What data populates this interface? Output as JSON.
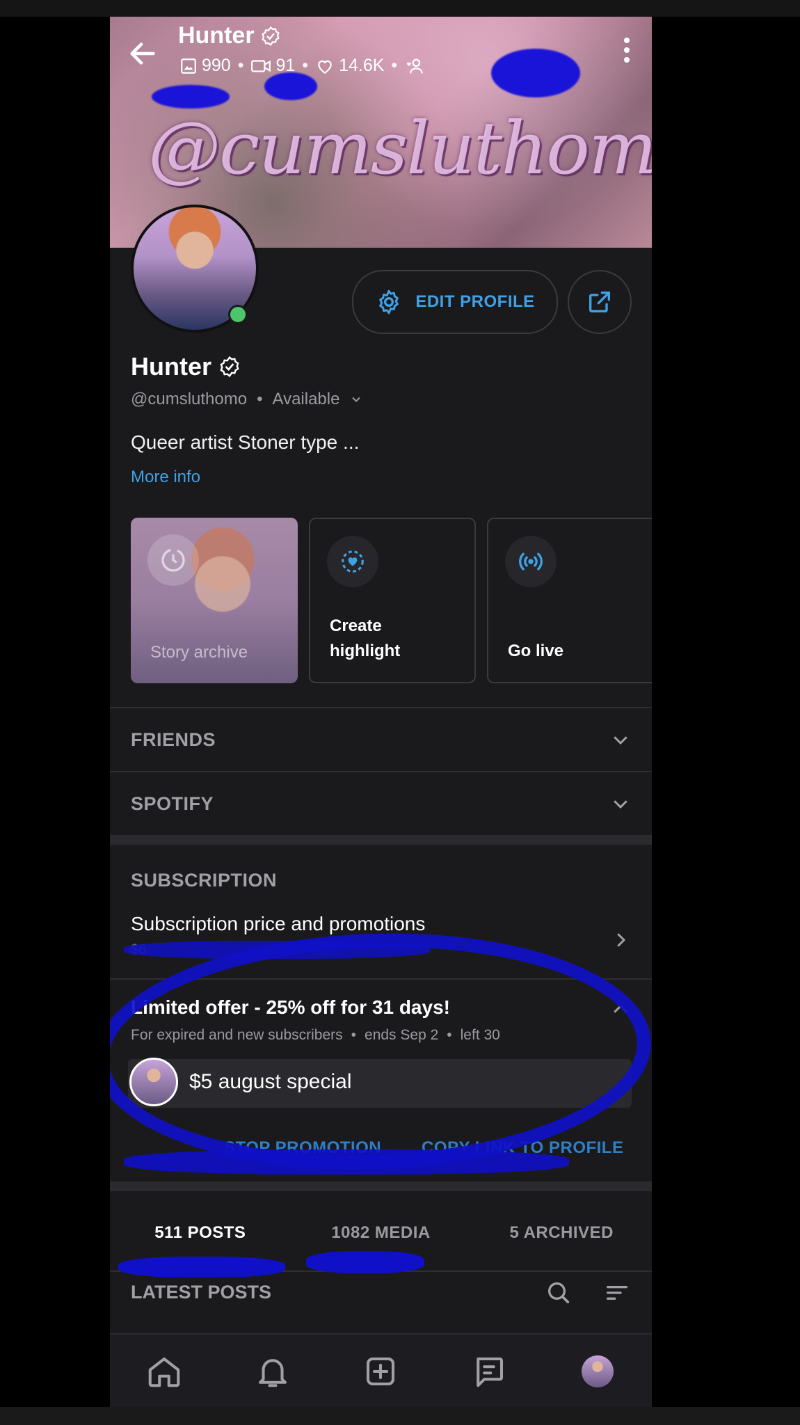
{
  "header": {
    "title": "Hunter",
    "stats": {
      "photos": "990",
      "videos": "91",
      "likes": "14.6K"
    },
    "banner_text": "@cumsluthomo"
  },
  "profile": {
    "name": "Hunter",
    "handle": "@cumsluthomo",
    "status": "Available",
    "bio": "Queer artist Stoner type ...",
    "more_info": "More info",
    "edit_button": "EDIT PROFILE"
  },
  "story_cards": [
    {
      "label": "Story archive",
      "icon": "clock-icon"
    },
    {
      "label_line1": "Create",
      "label_line2": "highlight",
      "icon": "heart-icon"
    },
    {
      "label": "Go live",
      "icon": "broadcast-icon"
    }
  ],
  "sections": {
    "friends": "FRIENDS",
    "spotify": "SPOTIFY",
    "subscription": "SUBSCRIPTION"
  },
  "subscription": {
    "price_line": "Subscription price and promotions",
    "price_sub": "$6"
  },
  "offer": {
    "title": "Limited offer - 25% off for 31 days!",
    "audience": "For expired and new subscribers",
    "ends": "ends Sep 2",
    "left": "left 30",
    "promo_label": "$5 august special",
    "stop_label": "STOP PROMOTION",
    "copy_label": "COPY LINK TO PROFILE"
  },
  "tabs": [
    {
      "label": "511 POSTS",
      "active": true
    },
    {
      "label": "1082 MEDIA",
      "active": false
    },
    {
      "label": "5 ARCHIVED",
      "active": false
    }
  ],
  "latest_posts": "LATEST POSTS",
  "colors": {
    "accent": "#3fa2e6",
    "online": "#4cc56b",
    "scribble": "#1010c8"
  }
}
